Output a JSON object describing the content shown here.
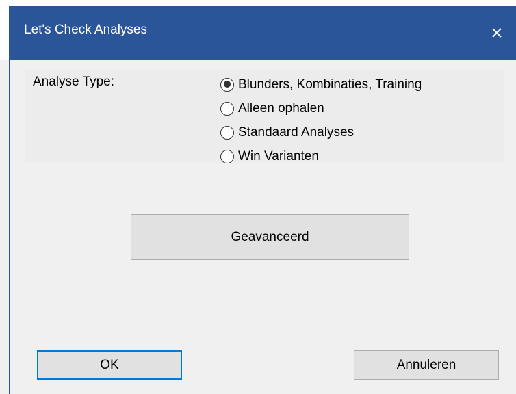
{
  "window": {
    "title": "Let's Check Analyses",
    "close_icon": "close-icon",
    "title_bar_color": "#2a5599"
  },
  "analyse": {
    "label": "Analyse Type:",
    "options": [
      {
        "label": "Blunders, Kombinaties, Training",
        "checked": true
      },
      {
        "label": "Alleen ophalen",
        "checked": false
      },
      {
        "label": "Standaard Analyses",
        "checked": false
      },
      {
        "label": "Win Varianten",
        "checked": false
      }
    ]
  },
  "buttons": {
    "advanced": "Geavanceerd",
    "ok": "OK",
    "cancel": "Annuleren"
  }
}
